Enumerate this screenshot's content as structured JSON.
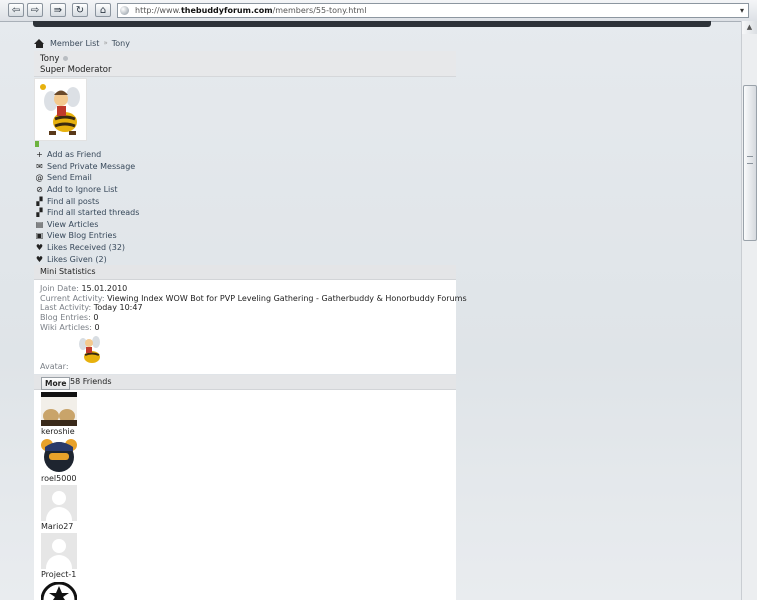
{
  "browser": {
    "url_prefix": "http://www.",
    "url_domain": "thebuddyforum.com",
    "url_path": "/members/55-tony.html",
    "back_glyph": "⇦",
    "forward_glyph": "⇨",
    "forward_all_glyph": "⇛",
    "reload_glyph": "↻",
    "home_glyph": "⌂",
    "dropdown_glyph": "▾"
  },
  "breadcrumb": {
    "items": [
      "Member List",
      "Tony"
    ],
    "separator": "»"
  },
  "profile": {
    "username": "Tony",
    "user_title": "Super Moderator"
  },
  "actions": [
    {
      "icon": "plus-icon",
      "glyph": "+",
      "label": "Add as Friend"
    },
    {
      "icon": "envelope-icon",
      "glyph": "✉",
      "label": "Send Private Message"
    },
    {
      "icon": "at-icon",
      "glyph": "@",
      "label": "Send Email"
    },
    {
      "icon": "ignore-icon",
      "glyph": "⊘",
      "label": "Add to Ignore List"
    },
    {
      "icon": "posts-icon",
      "glyph": "▞",
      "label": "Find all posts"
    },
    {
      "icon": "threads-icon",
      "glyph": "▞",
      "label": "Find all started threads"
    },
    {
      "icon": "articles-icon",
      "glyph": "▤",
      "label": "View Articles"
    },
    {
      "icon": "blog-icon",
      "glyph": "▣",
      "label": "View Blog Entries"
    },
    {
      "icon": "heart-icon",
      "glyph": "♥",
      "label": "Likes Received (32)"
    },
    {
      "icon": "heart-icon",
      "glyph": "♥",
      "label": "Likes Given (2)"
    }
  ],
  "mini_stats": {
    "header": "Mini Statistics",
    "join_date_label": "Join Date:",
    "join_date": "15.01.2010",
    "activity_label": "Current Activity:",
    "activity": "Viewing Index WOW Bot for PVP Leveling Gathering - Gatherbuddy & Honorbuddy Forums",
    "last_activity_label": "Last Activity:",
    "last_activity": "Today 10:47",
    "blog_label": "Blog Entries:",
    "blog_entries": "0",
    "wiki_label": "Wiki Articles:",
    "wiki_articles": "0",
    "avatar_label": "Avatar:"
  },
  "friends": {
    "more_label": "More",
    "count_label": "58 Friends",
    "list": [
      {
        "name": "keroshie"
      },
      {
        "name": "roel5000"
      },
      {
        "name": "Mario27"
      },
      {
        "name": "Project-1"
      }
    ]
  }
}
